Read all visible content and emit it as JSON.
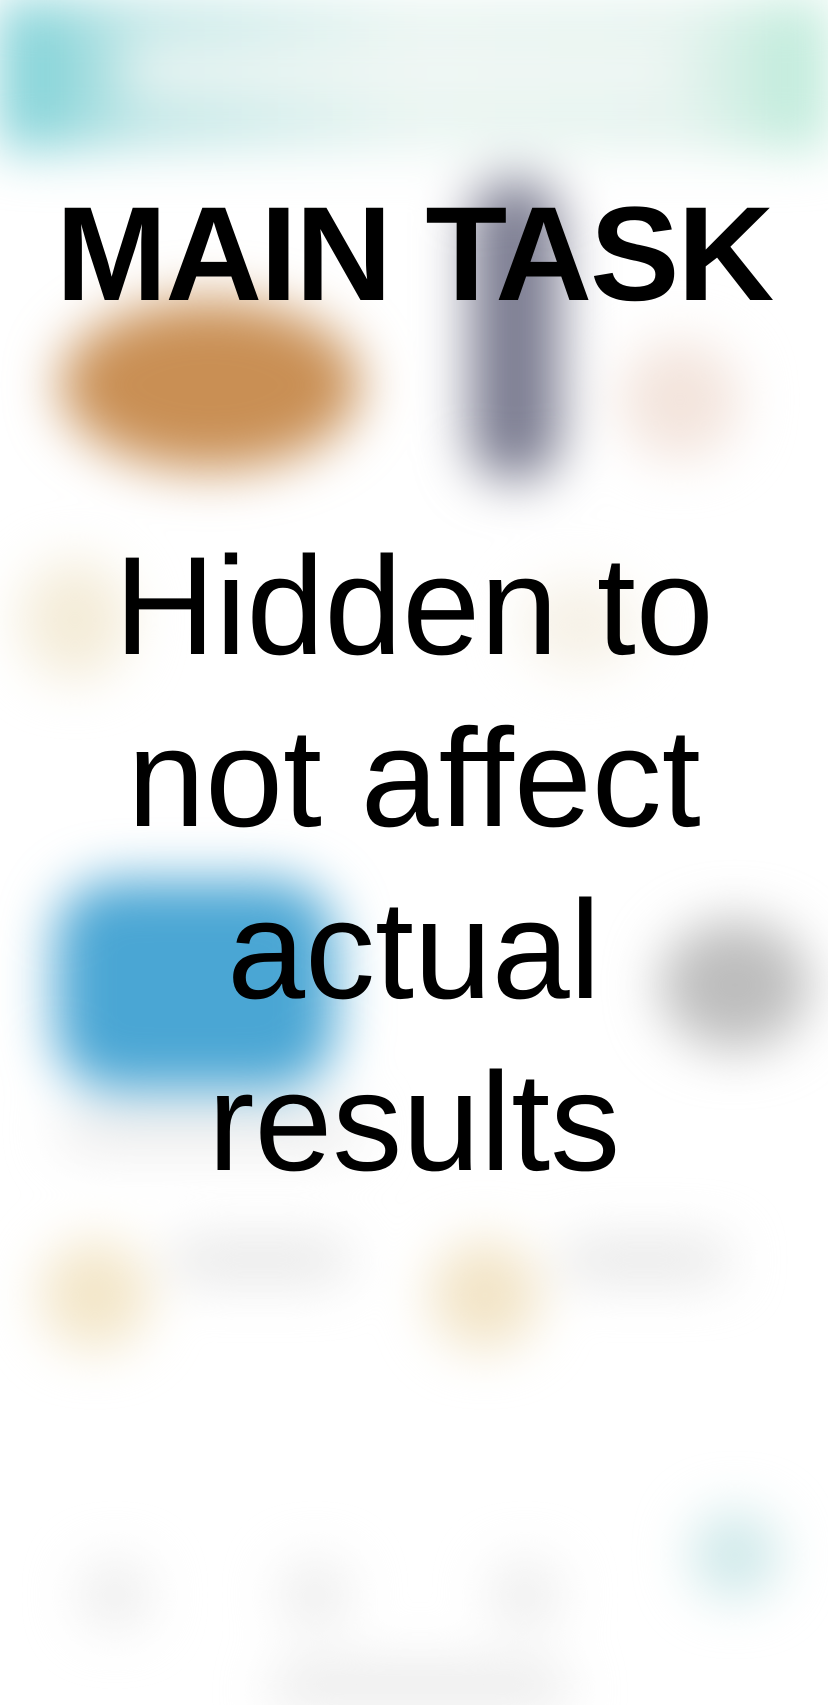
{
  "overlay": {
    "title": "MAIN TASK",
    "message": "Hidden to not affect actual results"
  },
  "colors": {
    "header_teal": "#5ec7cf",
    "header_mint": "#a9e6cf",
    "accent_blue": "#4aa6d4",
    "accent_orange": "#cf9a5a",
    "text": "#000000",
    "background": "#ffffff"
  }
}
